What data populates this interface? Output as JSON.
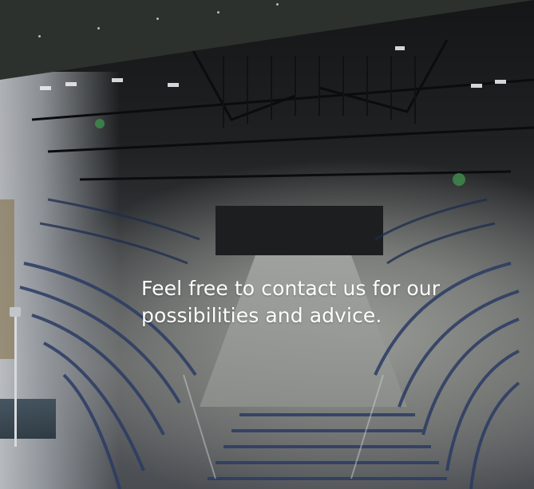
{
  "hero": {
    "headline": "Feel free to contact us for our possibilities and advice.",
    "image_icon": "arena-photo",
    "colors": {
      "header_band": "#2d312d",
      "text": "#ffffff"
    }
  }
}
